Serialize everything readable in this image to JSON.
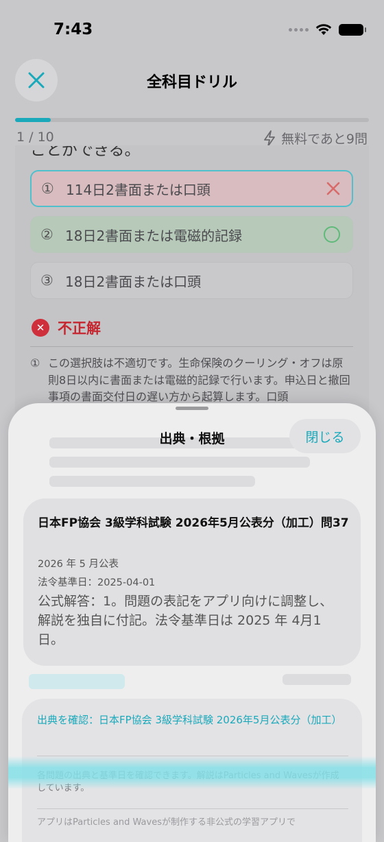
{
  "status_bar": {
    "time": "7:43"
  },
  "nav": {
    "title": "全科目ドリル"
  },
  "progress": {
    "fraction": 0.1,
    "count_label": "1 / 10",
    "quota_label": "無料であと9問"
  },
  "question": {
    "partial_text": "ことができる。",
    "options": [
      {
        "num": "①",
        "text": "114日2書面または口頭",
        "state": "incorrect-selected"
      },
      {
        "num": "②",
        "text": "18日2書面または電磁的記録",
        "state": "correct"
      },
      {
        "num": "③",
        "text": "18日2書面または口頭",
        "state": "neutral"
      }
    ]
  },
  "result": {
    "label": "不正解"
  },
  "explanation": {
    "num": "①",
    "text": "この選択肢は不適切です。生命保険のクーリング・オフは原則8日以内に書面または電磁的記録で行います。申込日と撤回事項の書面交付日の遅い方から起算します。口頭"
  },
  "sheet": {
    "title": "出典・根拠",
    "close_label": "閉じる",
    "source": {
      "title": "日本FP協会 3級学科試験 2026年5月公表分（加工）問37",
      "published": "2026 年 5 月公表",
      "base_date": "法令基準日：2025-04-01",
      "answer_note": "公式解答：1。問題の表記をアプリ向けに調整し、解説を独自に付記。法令基準日は 2025 年 4月1日。"
    },
    "confirm": {
      "link": "出典を確認：日本FP協会 3級学科試験 2026年5月公表分（加工）",
      "note": "各問題の出典と基準日を確認できます。解説はParticles and Wavesが作成しています。",
      "more": "アプリはParticles and Wavesが制作する非公式の学習アプリで"
    }
  },
  "colors": {
    "accent": "#1aa9bb",
    "error": "#c5262f",
    "correct": "#5fb979"
  }
}
